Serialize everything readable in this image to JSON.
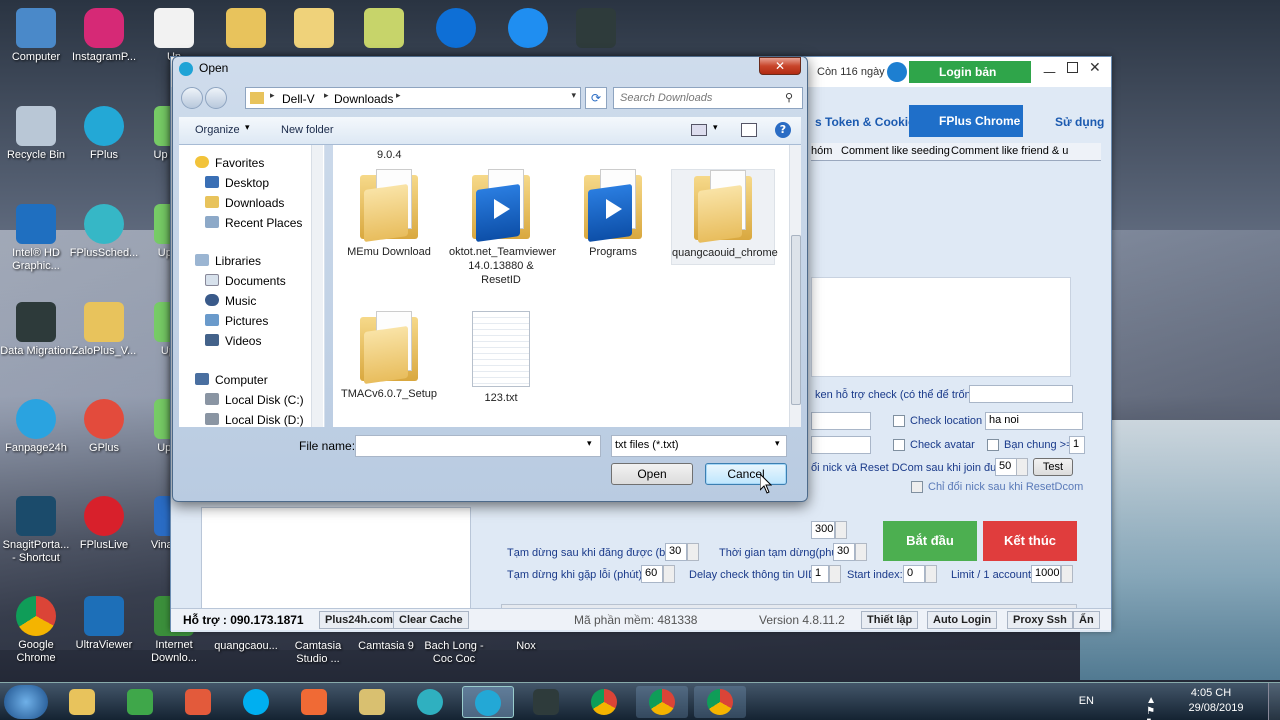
{
  "desktop": {
    "icons_col1": [
      "Computer",
      "Recycle Bin",
      "Intel® HD Graphic...",
      "Data Migration",
      "Fanpage24h",
      "SnagitPorta... - Shortcut",
      "Google Chrome"
    ],
    "icons_col2": [
      "InstagramP...",
      "FPlus",
      "FPlusSched...",
      "ZaloPlus_V...",
      "GPlus",
      "FPlusLive",
      "UltraViewer"
    ],
    "icons_col3": [
      "Un",
      "Up Insta",
      "Up Zal",
      "Upda",
      "Up FPl",
      "Vina Mob",
      "Internet Downlo..."
    ],
    "bottom_icons": [
      "quangcaou...",
      "Camtasia Studio ...",
      "Camtasia 9",
      "Bach Long - Coc Coc",
      "Nox"
    ]
  },
  "app": {
    "trial": "Còn 116 ngày",
    "login_button": "Login bản quyền",
    "top_tabs": [
      "s Token & Cookie",
      "FPlus Chrome",
      "Sử dụng"
    ],
    "sub_tabs": [
      "hóm",
      "Comment like seeding",
      "Comment like friend & u"
    ],
    "token_label": "ken hỗ trợ check (có thể để trống)",
    "check_location": "Check location",
    "location_value": "ha noi",
    "check_avatar": "Check avatar",
    "ban_chung": "Bạn chung >=",
    "ban_chung_value": "1",
    "reset_label": "ổi nick và Reset DCom sau khi join được",
    "reset_value": "50",
    "test_button": "Test",
    "only_reset": "Chỉ đổi nick sau khi ResetDcom",
    "start_button": "Bắt đầu",
    "stop_button": "Kết thúc",
    "v300": "300",
    "pause_after_post": "Tạm dừng sau khi đăng được (bài)",
    "pause_after_post_value": "30",
    "pause_time": "Thời gian tạm dừng(phút)",
    "pause_time_value": "30",
    "pause_on_error": "Tạm dừng khi gặp lỗi (phút)",
    "pause_on_error_value": "60",
    "delay_uid": "Delay check thông tin UID",
    "delay_uid_value": "1",
    "start_index": "Start index:",
    "start_index_value": "0",
    "limit": "Limit / 1 account:",
    "limit_value": "1000",
    "footer": {
      "support": "Hỗ trợ : 090.173.1871",
      "site": "Plus24h.com",
      "clear_cache": "Clear Cache",
      "code": "Mã phần mềm: 481338",
      "version": "Version 4.8.11.2",
      "setup": "Thiết lập",
      "auto_login": "Auto Login",
      "proxy": "Proxy Ssh",
      "hide": "Ẩn"
    }
  },
  "dialog": {
    "title": "Open",
    "path": [
      "Dell-V",
      "Downloads"
    ],
    "search_placeholder": "Search Downloads",
    "organize": "Organize",
    "new_folder": "New folder",
    "nav": {
      "favorites": "Favorites",
      "desktop": "Desktop",
      "downloads": "Downloads",
      "recent": "Recent Places",
      "libraries": "Libraries",
      "documents": "Documents",
      "music": "Music",
      "pictures": "Pictures",
      "videos": "Videos",
      "computer": "Computer",
      "local_c": "Local Disk (C:)",
      "local_d": "Local Disk (D:)"
    },
    "partial_label": "9.0.4",
    "files": [
      {
        "name": "MEmu Download",
        "type": "folder"
      },
      {
        "name": "oktot.net_Teamviewer 14.0.13880 & ResetID",
        "type": "folder-tv"
      },
      {
        "name": "Programs",
        "type": "folder-tv"
      },
      {
        "name": "quangcaouid_chrome",
        "type": "folder"
      },
      {
        "name": "TMACv6.0.7_Setup",
        "type": "folder"
      },
      {
        "name": "123.txt",
        "type": "txt"
      }
    ],
    "file_name_label": "File name:",
    "file_name_value": "",
    "filter": "txt files (*.txt)",
    "open_button": "Open",
    "cancel_button": "Cancel"
  },
  "tray": {
    "lang": "EN",
    "time": "4:05 CH",
    "date": "29/08/2019"
  }
}
